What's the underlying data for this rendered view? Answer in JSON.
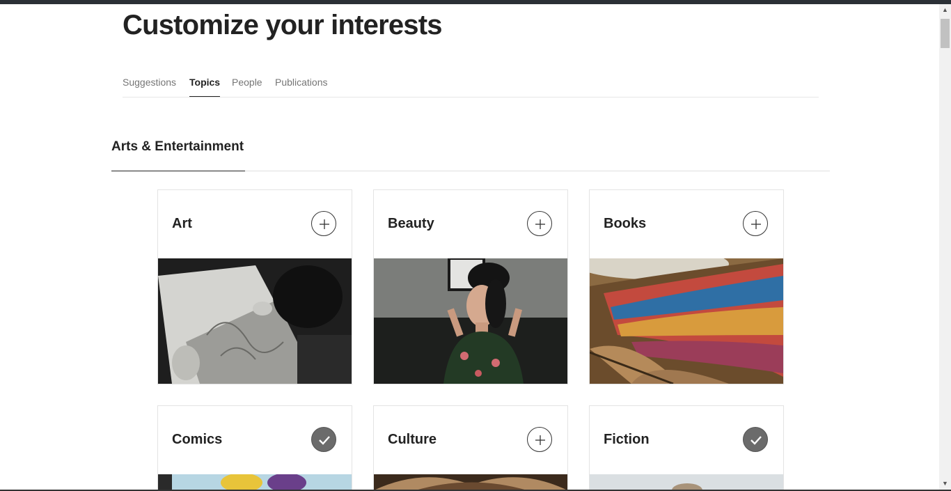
{
  "page": {
    "title": "Customize your interests"
  },
  "tabs": [
    {
      "label": "Suggestions",
      "active": false
    },
    {
      "label": "Topics",
      "active": true
    },
    {
      "label": "People",
      "active": false
    },
    {
      "label": "Publications",
      "active": false
    }
  ],
  "section": {
    "title": "Arts & Entertainment"
  },
  "topics": [
    {
      "name": "Art",
      "followed": false,
      "icon": "plus-icon"
    },
    {
      "name": "Beauty",
      "followed": false,
      "icon": "plus-icon"
    },
    {
      "name": "Books",
      "followed": false,
      "icon": "plus-icon"
    },
    {
      "name": "Comics",
      "followed": true,
      "icon": "check-icon"
    },
    {
      "name": "Culture",
      "followed": false,
      "icon": "plus-icon"
    },
    {
      "name": "Fiction",
      "followed": true,
      "icon": "check-icon"
    }
  ],
  "colors": {
    "text": "#222222",
    "muted": "#757575",
    "followed": "#6b6b6b"
  }
}
